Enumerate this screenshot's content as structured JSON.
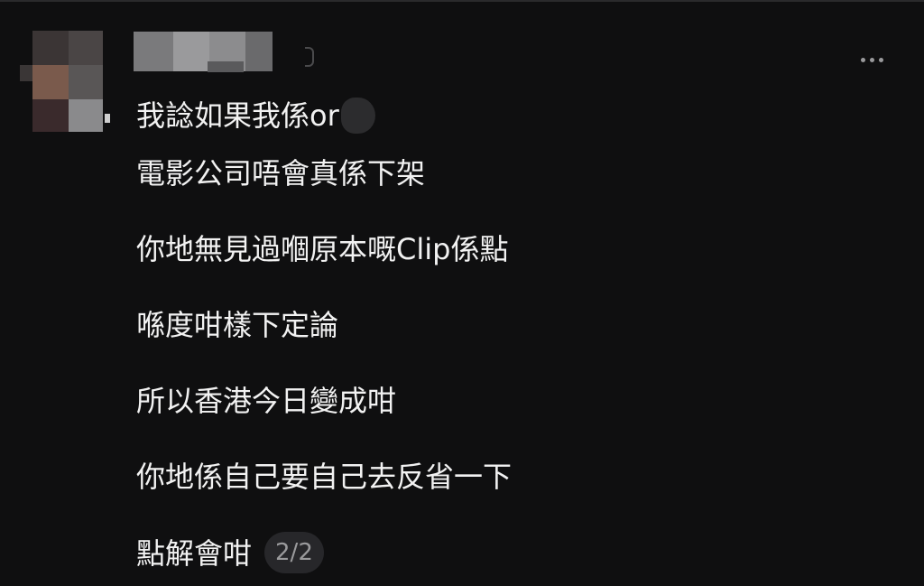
{
  "header": {
    "menu_icon": "more-horizontal-icon"
  },
  "message": {
    "line1": "我諗如果我係or",
    "line2": "電影公司唔會真係下架",
    "line3": "你地無見過嗰原本嘅Clip係點",
    "line4": "喺度咁樣下定論",
    "line5": "所以香港今日變成咁",
    "line6": "你地係自己要自己去反省一下",
    "line7": "點解會咁",
    "page_indicator": "2/2"
  },
  "colors": {
    "background": "#0f0f10",
    "text": "#f2f2f2",
    "badge_bg": "#27272a",
    "badge_text": "#9a9a9c"
  }
}
